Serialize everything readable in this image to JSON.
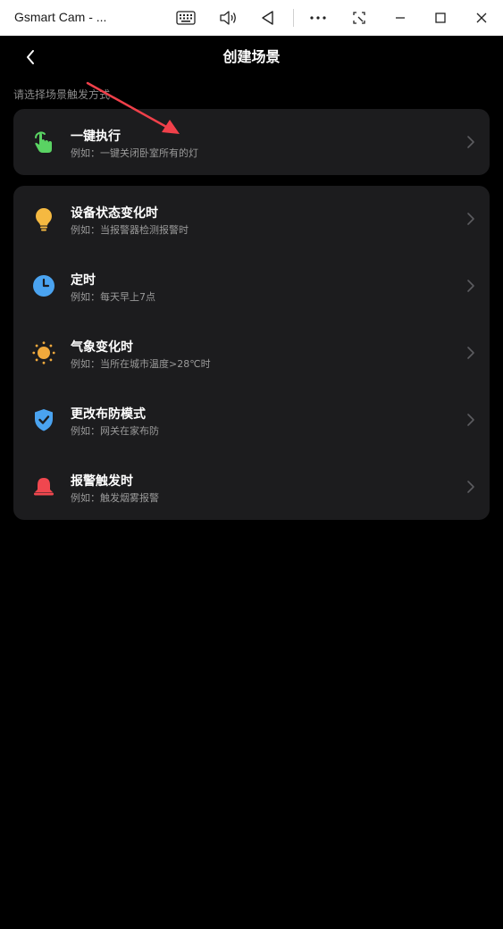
{
  "window": {
    "title": "Gsmart Cam - ..."
  },
  "header": {
    "title": "创建场景"
  },
  "section_label": "请选择场景触发方式",
  "primary": {
    "title": "一键执行",
    "subtitle": "例如：一键关闭卧室所有的灯",
    "icon": "tap-hand-icon"
  },
  "triggers": [
    {
      "title": "设备状态变化时",
      "subtitle": "例如：当报警器检测报警时",
      "icon": "bulb-icon"
    },
    {
      "title": "定时",
      "subtitle": "例如：每天早上7点",
      "icon": "clock-icon"
    },
    {
      "title": "气象变化时",
      "subtitle": "例如：当所在城市温度>28℃时",
      "icon": "sun-icon"
    },
    {
      "title": "更改布防模式",
      "subtitle": "例如：网关在家布防",
      "icon": "shield-check-icon"
    },
    {
      "title": "报警触发时",
      "subtitle": "例如：触发烟雾报警",
      "icon": "alarm-bell-icon"
    }
  ],
  "colors": {
    "background": "#000000",
    "card": "#1c1c1e",
    "green": "#5ad363",
    "yellow": "#f5b941",
    "blue": "#4aa3f0",
    "orange": "#f0a93c",
    "red": "#f0474f",
    "annotation": "#f0404a"
  }
}
